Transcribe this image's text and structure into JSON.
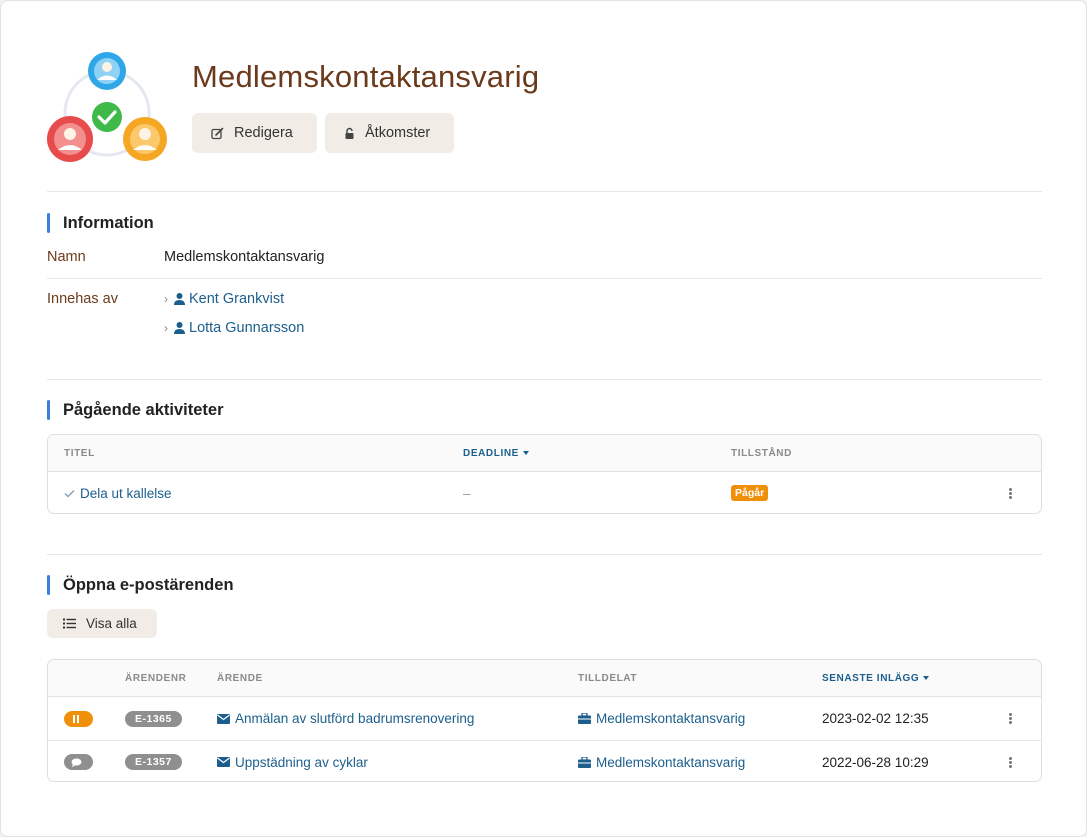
{
  "header": {
    "title": "Medlemskontaktansvarig",
    "edit_label": "Redigera",
    "access_label": "Åtkomster"
  },
  "information": {
    "section_title": "Information",
    "name_label": "Namn",
    "name_value": "Medlemskontaktansvarig",
    "holders_label": "Innehas av",
    "holders": [
      "Kent Grankvist",
      "Lotta Gunnarsson"
    ]
  },
  "activities": {
    "section_title": "Pågående aktiviteter",
    "columns": {
      "title": "TITEL",
      "deadline": "DEADLINE",
      "state": "TILLSTÅND"
    },
    "rows": [
      {
        "title": "Dela ut kallelse",
        "deadline": "–",
        "state": "Pågår"
      }
    ]
  },
  "emails": {
    "section_title": "Öppna e-postärenden",
    "show_all_label": "Visa alla",
    "columns": {
      "case_no": "ÄRENDENR",
      "subject": "ÄRENDE",
      "assigned": "TILLDELAT",
      "latest": "SENASTE INLÄGG"
    },
    "rows": [
      {
        "status": "paused",
        "case_no": "E-1365",
        "subject": "Anmälan av slutförd badrumsrenovering",
        "assigned": "Medlemskontaktansvarig",
        "latest": "2023-02-02 12:35"
      },
      {
        "status": "comment",
        "case_no": "E-1357",
        "subject": "Uppstädning av cyklar",
        "assigned": "Medlemskontaktansvarig",
        "latest": "2022-06-28 10:29"
      }
    ]
  },
  "colors": {
    "title_brown": "#6b3a1c",
    "link_blue": "#1c5f8c",
    "accent_blue": "#3a7fe0",
    "warning_orange": "#f0900a",
    "button_beige": "#f1ece6"
  },
  "icons": [
    "role-group-icon",
    "edit-icon",
    "lock-icon",
    "chevron-right-icon",
    "user-icon",
    "check-icon",
    "pause-icon",
    "comment-icon",
    "envelope-icon",
    "briefcase-icon",
    "list-icon",
    "kebab-menu-icon"
  ]
}
